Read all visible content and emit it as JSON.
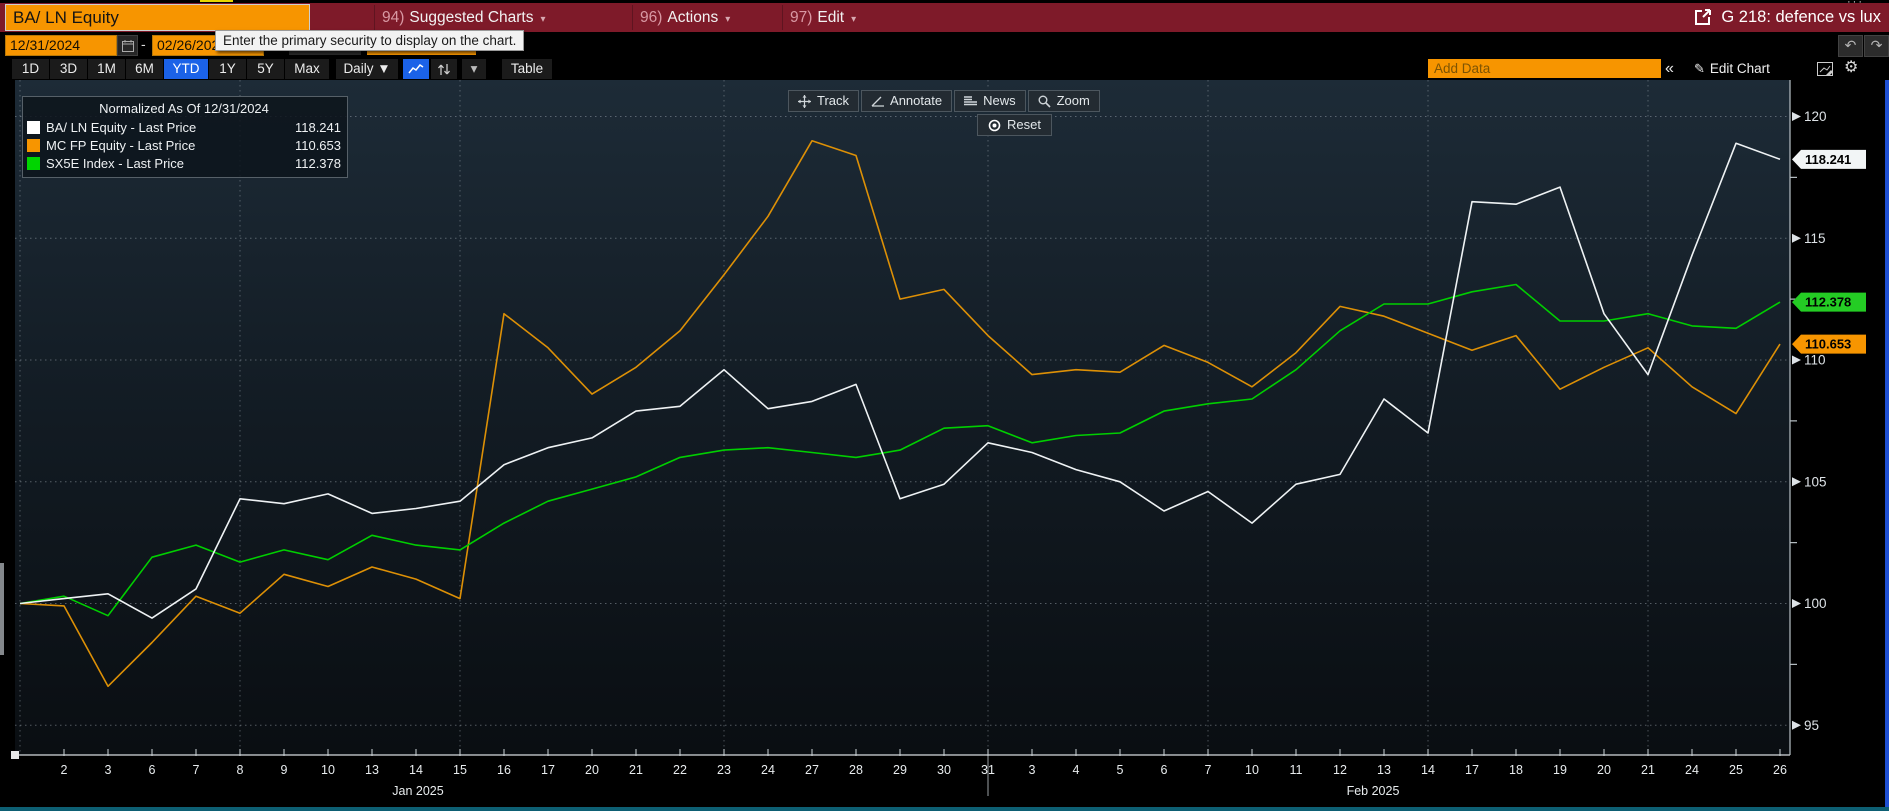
{
  "titlebar": {
    "security": "BA/ LN Equity",
    "menus": [
      {
        "num": "94)",
        "label": "Suggested Charts",
        "arrow": "▾"
      },
      {
        "num": "96)",
        "label": "Actions",
        "arrow": "▾"
      },
      {
        "num": "97)",
        "label": "Edit",
        "arrow": "▾"
      }
    ],
    "export_title": "G 218: defence vs lux",
    "window_dots": "···"
  },
  "tooltip_text": "Enter the primary security to display on the chart.",
  "daterow": {
    "start_date": "12/31/2024",
    "separator": "-",
    "end_date": "02/26/2025",
    "undo": "↶",
    "redo": "↷"
  },
  "toolbar": {
    "ranges": [
      "1D",
      "3D",
      "1M",
      "6M",
      "YTD",
      "1Y",
      "5Y",
      "Max"
    ],
    "active_range": "YTD",
    "frequency": "Daily ▼",
    "table_label": "Table",
    "dropdown_arrow": "▾",
    "add_data_placeholder": "Add Data",
    "collapse_label": "«",
    "pencil": "✎",
    "edit_chart_label": "Edit Chart",
    "gear": "⚙"
  },
  "chart_toolbar": {
    "buttons": [
      {
        "icon": "track-icon",
        "label": "Track"
      },
      {
        "icon": "annotate-icon",
        "label": "Annotate"
      },
      {
        "icon": "news-icon",
        "label": "News"
      },
      {
        "icon": "zoom-icon",
        "label": "Zoom"
      }
    ],
    "reset_label": "Reset"
  },
  "legend": {
    "title": "Normalized As Of 12/31/2024",
    "items": [
      {
        "color": "#ffffff",
        "label": "BA/ LN Equity - Last Price",
        "value": "118.241"
      },
      {
        "color": "#f79500",
        "label": "MC FP Equity - Last Price",
        "value": "110.653"
      },
      {
        "color": "#00d500",
        "label": "SX5E Index - Last Price",
        "value": "112.378"
      }
    ]
  },
  "chart_data": {
    "type": "line",
    "title": "Normalized As Of 12/31/2024",
    "x_start_label": "12/31/2024",
    "x_tick_labels": [
      "2",
      "3",
      "6",
      "7",
      "8",
      "9",
      "10",
      "13",
      "14",
      "15",
      "16",
      "17",
      "20",
      "21",
      "22",
      "23",
      "24",
      "27",
      "28",
      "29",
      "30",
      "31",
      "3",
      "4",
      "5",
      "6",
      "7",
      "10",
      "11",
      "12",
      "13",
      "14",
      "17",
      "18",
      "19",
      "20",
      "21",
      "24",
      "25",
      "26"
    ],
    "month_labels": [
      "Jan 2025",
      "Feb 2025"
    ],
    "yticks": [
      95,
      100,
      105,
      110,
      115,
      120
    ],
    "y_minor_ticks": [
      97.5,
      102.5,
      107.5,
      112.5,
      117.5
    ],
    "ylim": [
      93.8,
      121.5
    ],
    "grid_vertical_indices": [
      0,
      5,
      10,
      16,
      22,
      27,
      32,
      37
    ],
    "legend_position": "top-left",
    "series": [
      {
        "name": "MC FP Equity - Last Price",
        "color": "#dd9006",
        "tag_color": "#f79500",
        "last": "110.653",
        "values": [
          100,
          99.9,
          96.6,
          98.4,
          100.3,
          99.6,
          101.2,
          100.7,
          101.5,
          101.0,
          100.2,
          111.9,
          110.5,
          108.6,
          109.7,
          111.2,
          113.5,
          115.9,
          119.0,
          118.4,
          112.5,
          112.9,
          111.0,
          109.4,
          109.6,
          109.5,
          110.6,
          109.9,
          108.9,
          110.3,
          112.2,
          111.8,
          111.1,
          110.4,
          111.0,
          108.8,
          109.7,
          110.5,
          108.9,
          107.8,
          110.653
        ]
      },
      {
        "name": "SX5E Index - Last Price",
        "color": "#00cf00",
        "tag_color": "#24cc24",
        "last": "112.378",
        "values": [
          100,
          100.3,
          99.5,
          101.9,
          102.4,
          101.7,
          102.2,
          101.8,
          102.8,
          102.4,
          102.2,
          103.3,
          104.2,
          104.7,
          105.2,
          106.0,
          106.3,
          106.4,
          106.2,
          106.0,
          106.3,
          107.2,
          107.3,
          106.6,
          106.9,
          107.0,
          107.9,
          108.2,
          108.4,
          109.6,
          111.2,
          112.3,
          112.3,
          112.8,
          113.1,
          111.6,
          111.6,
          111.9,
          111.4,
          111.3,
          112.378
        ]
      },
      {
        "name": "BA/ LN Equity - Last Price",
        "color": "#eef2f4",
        "tag_color": "#f2f5f6",
        "last": "118.241",
        "values": [
          100,
          100.2,
          100.4,
          99.4,
          100.6,
          104.3,
          104.1,
          104.5,
          103.7,
          103.9,
          104.2,
          105.7,
          106.4,
          106.8,
          107.9,
          108.1,
          109.6,
          108.0,
          108.3,
          109.0,
          104.3,
          104.9,
          106.6,
          106.2,
          105.5,
          105.0,
          103.8,
          104.6,
          103.3,
          104.9,
          105.3,
          108.4,
          107.0,
          116.5,
          116.4,
          117.1,
          111.9,
          109.4,
          114.3,
          118.9,
          118.241
        ]
      }
    ]
  }
}
